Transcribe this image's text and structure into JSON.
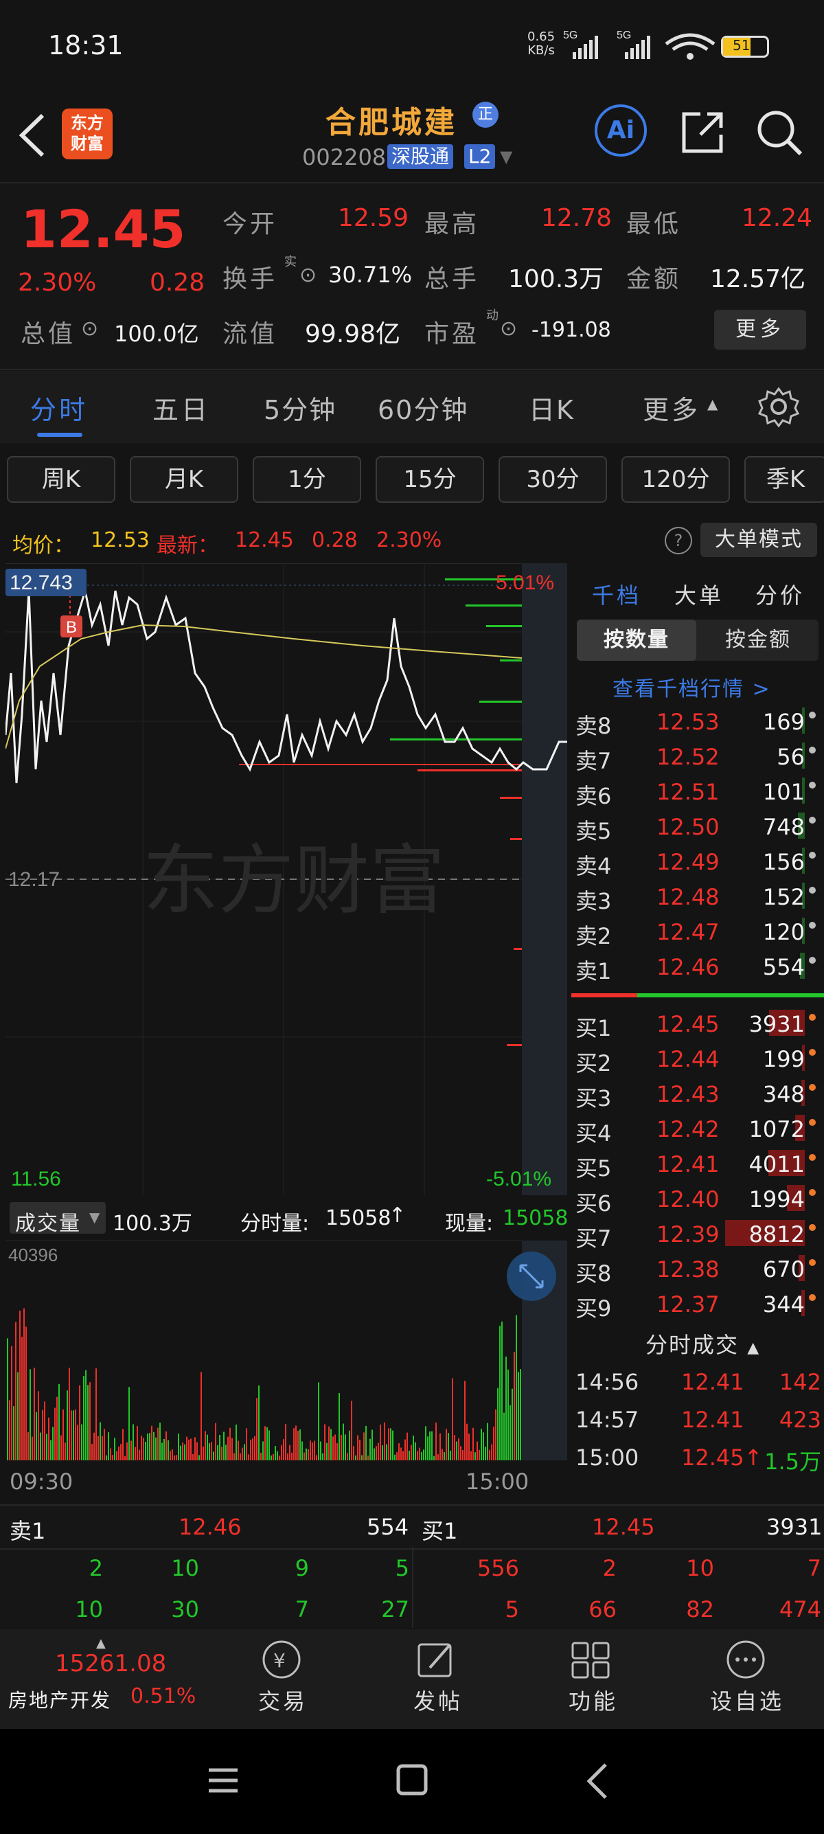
{
  "status_bar": {
    "time": "18:31",
    "net_speed_value": "0.65",
    "net_speed_unit": "KB/s",
    "sig1": "5G",
    "sig2": "5G",
    "battery": "51"
  },
  "header": {
    "logo_line1": "东方",
    "logo_line2": "财富",
    "title": "合肥城建",
    "title_badge": "正",
    "code": "002208",
    "tag1": "深股通",
    "tag2": "L2",
    "ai_label": "Ai"
  },
  "quote": {
    "price": "12.45",
    "change_pct": "2.30%",
    "change": "0.28",
    "open_label": "今开",
    "open": "12.59",
    "high_label": "最高",
    "high": "12.78",
    "low_label": "最低",
    "low": "12.24",
    "turnover_label": "换手",
    "turnover_sup": "实",
    "turnover": "30.71%",
    "vol_label": "总手",
    "vol": "100.3万",
    "amount_label": "金额",
    "amount": "12.57亿",
    "mktcap_label": "总值",
    "mktcap": "100.0亿",
    "float_label": "流值",
    "float": "99.98亿",
    "pe_label": "市盈",
    "pe_sup": "动",
    "pe": "-191.08",
    "more_btn": "更多"
  },
  "tabs": [
    {
      "label": "分时",
      "active": true
    },
    {
      "label": "五日"
    },
    {
      "label": "5分钟"
    },
    {
      "label": "60分钟"
    },
    {
      "label": "日K"
    },
    {
      "label": "更多"
    }
  ],
  "periods": [
    "周K",
    "月K",
    "1分",
    "15分",
    "30分",
    "120分",
    "季K"
  ],
  "avg_bar": {
    "avg_label": "均价：",
    "avg": "12.53",
    "latest_label": "最新：",
    "latest": "12.45",
    "change": "0.28",
    "pct": "2.30%",
    "mode_btn": "大单模式"
  },
  "chart": {
    "top_price": "12.743",
    "top_pct": "5.01%",
    "mid_price": "12.17",
    "low_price": "11.56",
    "low_pct": "-5.01%",
    "marker": "B",
    "watermark": "东方财富",
    "vol_selector": "成交量",
    "vol_total": "100.3万",
    "fenshi_label": "分时量:",
    "fenshi_val": "15058",
    "xianliang_label": "现量:",
    "xianliang_val": "15058",
    "vol_max": "40396",
    "t_start": "09:30",
    "t_end": "15:00"
  },
  "chart_data": {
    "type": "line",
    "title": "",
    "ylim": [
      11.56,
      12.78
    ],
    "series": [
      {
        "values": [
          12.2,
          12.35,
          12.62,
          12.4,
          12.55,
          12.7,
          12.74,
          12.68,
          12.66,
          12.58,
          12.46,
          12.38,
          12.3,
          12.25,
          12.28,
          12.34,
          12.3,
          12.38,
          12.33,
          12.44,
          12.6,
          12.5,
          12.42,
          12.4,
          12.35,
          12.32,
          12.3,
          12.37,
          12.36
        ]
      },
      {
        "values": [
          12.3,
          12.43,
          12.5,
          12.53,
          12.55,
          12.56,
          12.57,
          12.56,
          12.55,
          12.55,
          12.54,
          12.54,
          12.53
        ]
      }
    ]
  },
  "panel": {
    "tabs": [
      "千档",
      "大单",
      "分价"
    ],
    "sub_tabs": [
      "按数量",
      "按金额"
    ],
    "link": "查看千档行情 >",
    "sells": [
      {
        "label": "卖8",
        "price": "12.53",
        "vol": "169"
      },
      {
        "label": "卖7",
        "price": "12.52",
        "vol": "56"
      },
      {
        "label": "卖6",
        "price": "12.51",
        "vol": "101"
      },
      {
        "label": "卖5",
        "price": "12.50",
        "vol": "748"
      },
      {
        "label": "卖4",
        "price": "12.49",
        "vol": "156"
      },
      {
        "label": "卖3",
        "price": "12.48",
        "vol": "152"
      },
      {
        "label": "卖2",
        "price": "12.47",
        "vol": "120"
      },
      {
        "label": "卖1",
        "price": "12.46",
        "vol": "554"
      }
    ],
    "buys": [
      {
        "label": "买1",
        "price": "12.45",
        "vol": "3931"
      },
      {
        "label": "买2",
        "price": "12.44",
        "vol": "199"
      },
      {
        "label": "买3",
        "price": "12.43",
        "vol": "348"
      },
      {
        "label": "买4",
        "price": "12.42",
        "vol": "1072"
      },
      {
        "label": "买5",
        "price": "12.41",
        "vol": "4011"
      },
      {
        "label": "买6",
        "price": "12.40",
        "vol": "1994"
      },
      {
        "label": "买7",
        "price": "12.39",
        "vol": "8812"
      },
      {
        "label": "买8",
        "price": "12.38",
        "vol": "670"
      },
      {
        "label": "买9",
        "price": "12.37",
        "vol": "344"
      }
    ],
    "ticks_title": "分时成交",
    "ticks": [
      {
        "t": "14:56",
        "p": "12.41",
        "v": "142"
      },
      {
        "t": "14:57",
        "p": "12.41",
        "v": "423"
      },
      {
        "t": "15:00",
        "p": "12.45↑",
        "v": "1.5万"
      }
    ]
  },
  "bottom_quote": {
    "sell_label": "卖1",
    "sell_price": "12.46",
    "sell_vol": "554",
    "buy_label": "买1",
    "buy_price": "12.45",
    "buy_vol": "3931",
    "left_row1": [
      "2",
      "10",
      "9",
      "5"
    ],
    "left_row2": [
      "10",
      "30",
      "7",
      "27"
    ],
    "right_row1": [
      "556",
      "2",
      "10",
      "7"
    ],
    "right_row2": [
      "5",
      "66",
      "82",
      "474"
    ]
  },
  "nav": {
    "index_value": "15261.08",
    "index_name": "房地产开发",
    "index_pct": "0.51%",
    "items": [
      "交易",
      "发帖",
      "功能",
      "设自选"
    ]
  }
}
